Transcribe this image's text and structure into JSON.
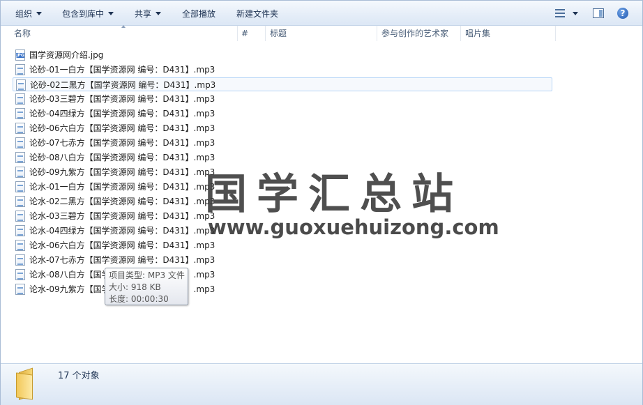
{
  "toolbar": {
    "organize": "组织",
    "include_library": "包含到库中",
    "share": "共享",
    "play_all": "全部播放",
    "new_folder": "新建文件夹"
  },
  "columns": {
    "name": "名称",
    "number": "#",
    "title": "标题",
    "artists": "参与创作的艺术家",
    "album": "唱片集"
  },
  "files": [
    {
      "name": "国学资源网介绍.jpg",
      "icon": "jpg-file-icon"
    },
    {
      "name": "论砂-01一白方【国学资源网 编号：D431】.mp3",
      "icon": "mp3-file-icon"
    },
    {
      "name": "论砂-02二黑方【国学资源网 编号：D431】.mp3",
      "icon": "mp3-file-icon",
      "selected": true
    },
    {
      "name": "论砂-03三碧方【国学资源网 编号：D431】.mp3",
      "icon": "mp3-file-icon"
    },
    {
      "name": "论砂-04四绿方【国学资源网 编号：D431】.mp3",
      "icon": "mp3-file-icon"
    },
    {
      "name": "论砂-06六白方【国学资源网 编号：D431】.mp3",
      "icon": "mp3-file-icon"
    },
    {
      "name": "论砂-07七赤方【国学资源网 编号：D431】.mp3",
      "icon": "mp3-file-icon"
    },
    {
      "name": "论砂-08八白方【国学资源网 编号：D431】.mp3",
      "icon": "mp3-file-icon"
    },
    {
      "name": "论砂-09九紫方【国学资源网 编号：D431】.mp3",
      "icon": "mp3-file-icon"
    },
    {
      "name": "论水-01一白方【国学资源网 编号：D431】.mp3",
      "icon": "mp3-file-icon"
    },
    {
      "name": "论水-02二黑方【国学资源网 编号：D431】.mp3",
      "icon": "mp3-file-icon"
    },
    {
      "name": "论水-03三碧方【国学资源网 编号：D431】.mp3",
      "icon": "mp3-file-icon"
    },
    {
      "name": "论水-04四绿方【国学资源网 编号：D431】.mp3",
      "icon": "mp3-file-icon"
    },
    {
      "name": "论水-06六白方【国学资源网 编号：D431】.mp3",
      "icon": "mp3-file-icon"
    },
    {
      "name": "论水-07七赤方【国学资源网 编号：D431】.mp3",
      "icon": "mp3-file-icon"
    },
    {
      "name": "论水-08八白方【国学资源网 编号：D431】.mp3",
      "icon": "mp3-file-icon"
    },
    {
      "name": "论水-09九紫方【国学资源网 编号：D431】.mp3",
      "icon": "mp3-file-icon"
    }
  ],
  "watermark": {
    "title": "国学汇总站",
    "url": "www.guoxuehuizong.com"
  },
  "tooltip": {
    "type": "项目类型: MP3 文件",
    "size": "大小: 918 KB",
    "length": "长度: 00:00:30"
  },
  "status": {
    "count": "17 个对象"
  },
  "colors": {
    "selection_border": "#b8d6f7",
    "toolbar_text": "#1e3353",
    "header_text": "#4c607a"
  }
}
